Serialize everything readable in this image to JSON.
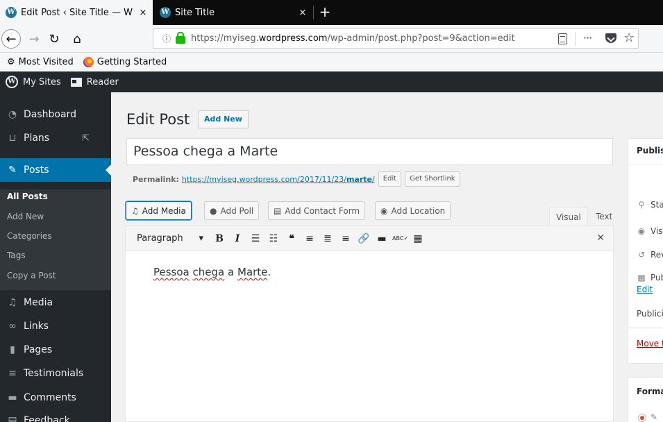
{
  "browser": {
    "tabs": [
      {
        "title": "Edit Post ‹ Site Title — W",
        "fade": "W",
        "close": "×"
      },
      {
        "title": "Site Title",
        "close": "×"
      }
    ],
    "new_tab": "+",
    "url_scheme_host_pre": "https://myiseg.",
    "url_host_bold": "wordpress.com",
    "url_path": "/wp-admin/post.php?post=9&action=edit",
    "more": "···",
    "bookmarks": [
      "Most Visited",
      "Getting Started"
    ]
  },
  "admin_bar": {
    "my_sites": "My Sites",
    "reader": "Reader"
  },
  "sidebar": {
    "items": [
      {
        "label": "Dashboard",
        "icon": "dashboard-icon"
      },
      {
        "label": "Plans",
        "icon": "cart-icon"
      },
      {
        "label": "Posts",
        "icon": "pin-icon"
      },
      {
        "label": "Media",
        "icon": "media-icon"
      },
      {
        "label": "Links",
        "icon": "link-icon"
      },
      {
        "label": "Pages",
        "icon": "page-icon"
      },
      {
        "label": "Testimonials",
        "icon": "testimonial-icon"
      },
      {
        "label": "Comments",
        "icon": "comment-icon"
      },
      {
        "label": "Feedback",
        "icon": "feedback-icon"
      }
    ],
    "submenu": [
      "All Posts",
      "Add New",
      "Categories",
      "Tags",
      "Copy a Post"
    ]
  },
  "editor": {
    "page_title": "Edit Post",
    "add_new": "Add New",
    "post_title": "Pessoa chega a Marte",
    "permalink_label": "Permalink:",
    "permalink_base": "https://myiseg.wordpress.com/2017/11/23/",
    "permalink_slug": "marte",
    "permalink_tail": "/",
    "edit_btn": "Edit",
    "shortlink_btn": "Get Shortlink",
    "media_buttons": [
      "Add Media",
      "Add Poll",
      "Add Contact Form",
      "Add Location"
    ],
    "tabs": [
      "Visual",
      "Text"
    ],
    "format": "Paragraph",
    "content": {
      "w1": "Pessoa",
      "w2": "chega",
      "w3": "a",
      "w4": "Marte",
      "end": "."
    }
  },
  "publish_box": {
    "title": "Publish",
    "status": "Status:",
    "visibility": "Visibility:",
    "revisions": "Revisions",
    "published_on": "Published on:",
    "edit_link": "Edit",
    "publicize": "Publicize:",
    "move_trash": "Move to Trash"
  },
  "format_box": {
    "title": "Format"
  }
}
